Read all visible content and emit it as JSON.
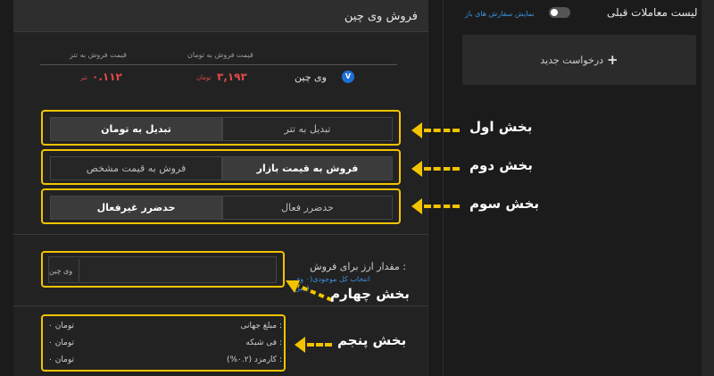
{
  "sell": {
    "title": "فروش وی چین",
    "columns": {
      "toman_price": "قیمت فروش به تومان",
      "tether_price": "قیمت فروش به تتر"
    },
    "coin": {
      "icon_letter": "V",
      "name": "وی چین",
      "price_toman": "۳,۱۹۳",
      "toman_unit": "تومان",
      "price_tether": "۰.۱۱۲",
      "tether_unit": "تتر"
    },
    "section1": {
      "left_label": "تبدیل به تومان",
      "right_label": "تبدیل به تتر",
      "active": "left"
    },
    "section2": {
      "left_label": "فروش به قیمت مشخص",
      "right_label": "فروش به قیمت بازار",
      "active": "right"
    },
    "section3": {
      "left_label": "حدضرر غیرفعال",
      "right_label": "حدضرر فعال",
      "active": "left"
    },
    "amount": {
      "label": "مقدار ارز برای فروش :",
      "unit": "وی چین",
      "select_all": "انتخاب کل موجودی(۰ وی",
      "select_all_2": "چین)"
    },
    "summary": [
      {
        "label": "مبلغ جهانی :",
        "value": "۰ تومان"
      },
      {
        "label": "فی شبکه :",
        "value": "۰ تومان"
      },
      {
        "label": "کارمزد (۰.۲%) :",
        "value": "۰ تومان"
      }
    ]
  },
  "annotations": [
    "بخش اول",
    "بخش دوم",
    "بخش سوم",
    "بخش چهارم",
    "بخش پنجم"
  ],
  "sidebar": {
    "title": "لیست معاملات قبلی",
    "toggle_label": "نمایش سفارش های باز",
    "toggle_on": false,
    "new_request_label": "درخواست جدید",
    "new_request_icon": "plus-icon"
  },
  "colors": {
    "highlight": "#f3c300",
    "price": "#e04848",
    "link": "#3d8fe0",
    "coin": "#1e6fd8"
  }
}
